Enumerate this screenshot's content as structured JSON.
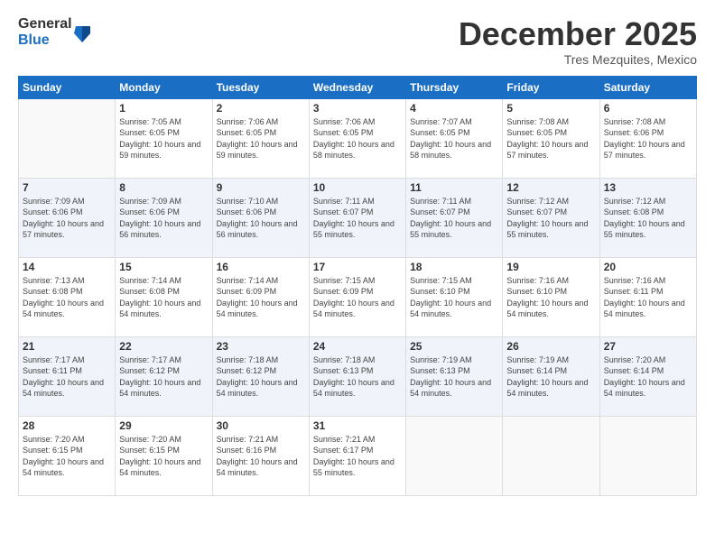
{
  "logo": {
    "general": "General",
    "blue": "Blue"
  },
  "title": "December 2025",
  "subtitle": "Tres Mezquites, Mexico",
  "weekdays": [
    "Sunday",
    "Monday",
    "Tuesday",
    "Wednesday",
    "Thursday",
    "Friday",
    "Saturday"
  ],
  "weeks": [
    [
      {
        "day": "",
        "sunrise": "",
        "sunset": "",
        "daylight": ""
      },
      {
        "day": "1",
        "sunrise": "Sunrise: 7:05 AM",
        "sunset": "Sunset: 6:05 PM",
        "daylight": "Daylight: 10 hours and 59 minutes."
      },
      {
        "day": "2",
        "sunrise": "Sunrise: 7:06 AM",
        "sunset": "Sunset: 6:05 PM",
        "daylight": "Daylight: 10 hours and 59 minutes."
      },
      {
        "day": "3",
        "sunrise": "Sunrise: 7:06 AM",
        "sunset": "Sunset: 6:05 PM",
        "daylight": "Daylight: 10 hours and 58 minutes."
      },
      {
        "day": "4",
        "sunrise": "Sunrise: 7:07 AM",
        "sunset": "Sunset: 6:05 PM",
        "daylight": "Daylight: 10 hours and 58 minutes."
      },
      {
        "day": "5",
        "sunrise": "Sunrise: 7:08 AM",
        "sunset": "Sunset: 6:05 PM",
        "daylight": "Daylight: 10 hours and 57 minutes."
      },
      {
        "day": "6",
        "sunrise": "Sunrise: 7:08 AM",
        "sunset": "Sunset: 6:06 PM",
        "daylight": "Daylight: 10 hours and 57 minutes."
      }
    ],
    [
      {
        "day": "7",
        "sunrise": "Sunrise: 7:09 AM",
        "sunset": "Sunset: 6:06 PM",
        "daylight": "Daylight: 10 hours and 57 minutes."
      },
      {
        "day": "8",
        "sunrise": "Sunrise: 7:09 AM",
        "sunset": "Sunset: 6:06 PM",
        "daylight": "Daylight: 10 hours and 56 minutes."
      },
      {
        "day": "9",
        "sunrise": "Sunrise: 7:10 AM",
        "sunset": "Sunset: 6:06 PM",
        "daylight": "Daylight: 10 hours and 56 minutes."
      },
      {
        "day": "10",
        "sunrise": "Sunrise: 7:11 AM",
        "sunset": "Sunset: 6:07 PM",
        "daylight": "Daylight: 10 hours and 55 minutes."
      },
      {
        "day": "11",
        "sunrise": "Sunrise: 7:11 AM",
        "sunset": "Sunset: 6:07 PM",
        "daylight": "Daylight: 10 hours and 55 minutes."
      },
      {
        "day": "12",
        "sunrise": "Sunrise: 7:12 AM",
        "sunset": "Sunset: 6:07 PM",
        "daylight": "Daylight: 10 hours and 55 minutes."
      },
      {
        "day": "13",
        "sunrise": "Sunrise: 7:12 AM",
        "sunset": "Sunset: 6:08 PM",
        "daylight": "Daylight: 10 hours and 55 minutes."
      }
    ],
    [
      {
        "day": "14",
        "sunrise": "Sunrise: 7:13 AM",
        "sunset": "Sunset: 6:08 PM",
        "daylight": "Daylight: 10 hours and 54 minutes."
      },
      {
        "day": "15",
        "sunrise": "Sunrise: 7:14 AM",
        "sunset": "Sunset: 6:08 PM",
        "daylight": "Daylight: 10 hours and 54 minutes."
      },
      {
        "day": "16",
        "sunrise": "Sunrise: 7:14 AM",
        "sunset": "Sunset: 6:09 PM",
        "daylight": "Daylight: 10 hours and 54 minutes."
      },
      {
        "day": "17",
        "sunrise": "Sunrise: 7:15 AM",
        "sunset": "Sunset: 6:09 PM",
        "daylight": "Daylight: 10 hours and 54 minutes."
      },
      {
        "day": "18",
        "sunrise": "Sunrise: 7:15 AM",
        "sunset": "Sunset: 6:10 PM",
        "daylight": "Daylight: 10 hours and 54 minutes."
      },
      {
        "day": "19",
        "sunrise": "Sunrise: 7:16 AM",
        "sunset": "Sunset: 6:10 PM",
        "daylight": "Daylight: 10 hours and 54 minutes."
      },
      {
        "day": "20",
        "sunrise": "Sunrise: 7:16 AM",
        "sunset": "Sunset: 6:11 PM",
        "daylight": "Daylight: 10 hours and 54 minutes."
      }
    ],
    [
      {
        "day": "21",
        "sunrise": "Sunrise: 7:17 AM",
        "sunset": "Sunset: 6:11 PM",
        "daylight": "Daylight: 10 hours and 54 minutes."
      },
      {
        "day": "22",
        "sunrise": "Sunrise: 7:17 AM",
        "sunset": "Sunset: 6:12 PM",
        "daylight": "Daylight: 10 hours and 54 minutes."
      },
      {
        "day": "23",
        "sunrise": "Sunrise: 7:18 AM",
        "sunset": "Sunset: 6:12 PM",
        "daylight": "Daylight: 10 hours and 54 minutes."
      },
      {
        "day": "24",
        "sunrise": "Sunrise: 7:18 AM",
        "sunset": "Sunset: 6:13 PM",
        "daylight": "Daylight: 10 hours and 54 minutes."
      },
      {
        "day": "25",
        "sunrise": "Sunrise: 7:19 AM",
        "sunset": "Sunset: 6:13 PM",
        "daylight": "Daylight: 10 hours and 54 minutes."
      },
      {
        "day": "26",
        "sunrise": "Sunrise: 7:19 AM",
        "sunset": "Sunset: 6:14 PM",
        "daylight": "Daylight: 10 hours and 54 minutes."
      },
      {
        "day": "27",
        "sunrise": "Sunrise: 7:20 AM",
        "sunset": "Sunset: 6:14 PM",
        "daylight": "Daylight: 10 hours and 54 minutes."
      }
    ],
    [
      {
        "day": "28",
        "sunrise": "Sunrise: 7:20 AM",
        "sunset": "Sunset: 6:15 PM",
        "daylight": "Daylight: 10 hours and 54 minutes."
      },
      {
        "day": "29",
        "sunrise": "Sunrise: 7:20 AM",
        "sunset": "Sunset: 6:15 PM",
        "daylight": "Daylight: 10 hours and 54 minutes."
      },
      {
        "day": "30",
        "sunrise": "Sunrise: 7:21 AM",
        "sunset": "Sunset: 6:16 PM",
        "daylight": "Daylight: 10 hours and 54 minutes."
      },
      {
        "day": "31",
        "sunrise": "Sunrise: 7:21 AM",
        "sunset": "Sunset: 6:17 PM",
        "daylight": "Daylight: 10 hours and 55 minutes."
      },
      {
        "day": "",
        "sunrise": "",
        "sunset": "",
        "daylight": ""
      },
      {
        "day": "",
        "sunrise": "",
        "sunset": "",
        "daylight": ""
      },
      {
        "day": "",
        "sunrise": "",
        "sunset": "",
        "daylight": ""
      }
    ]
  ]
}
